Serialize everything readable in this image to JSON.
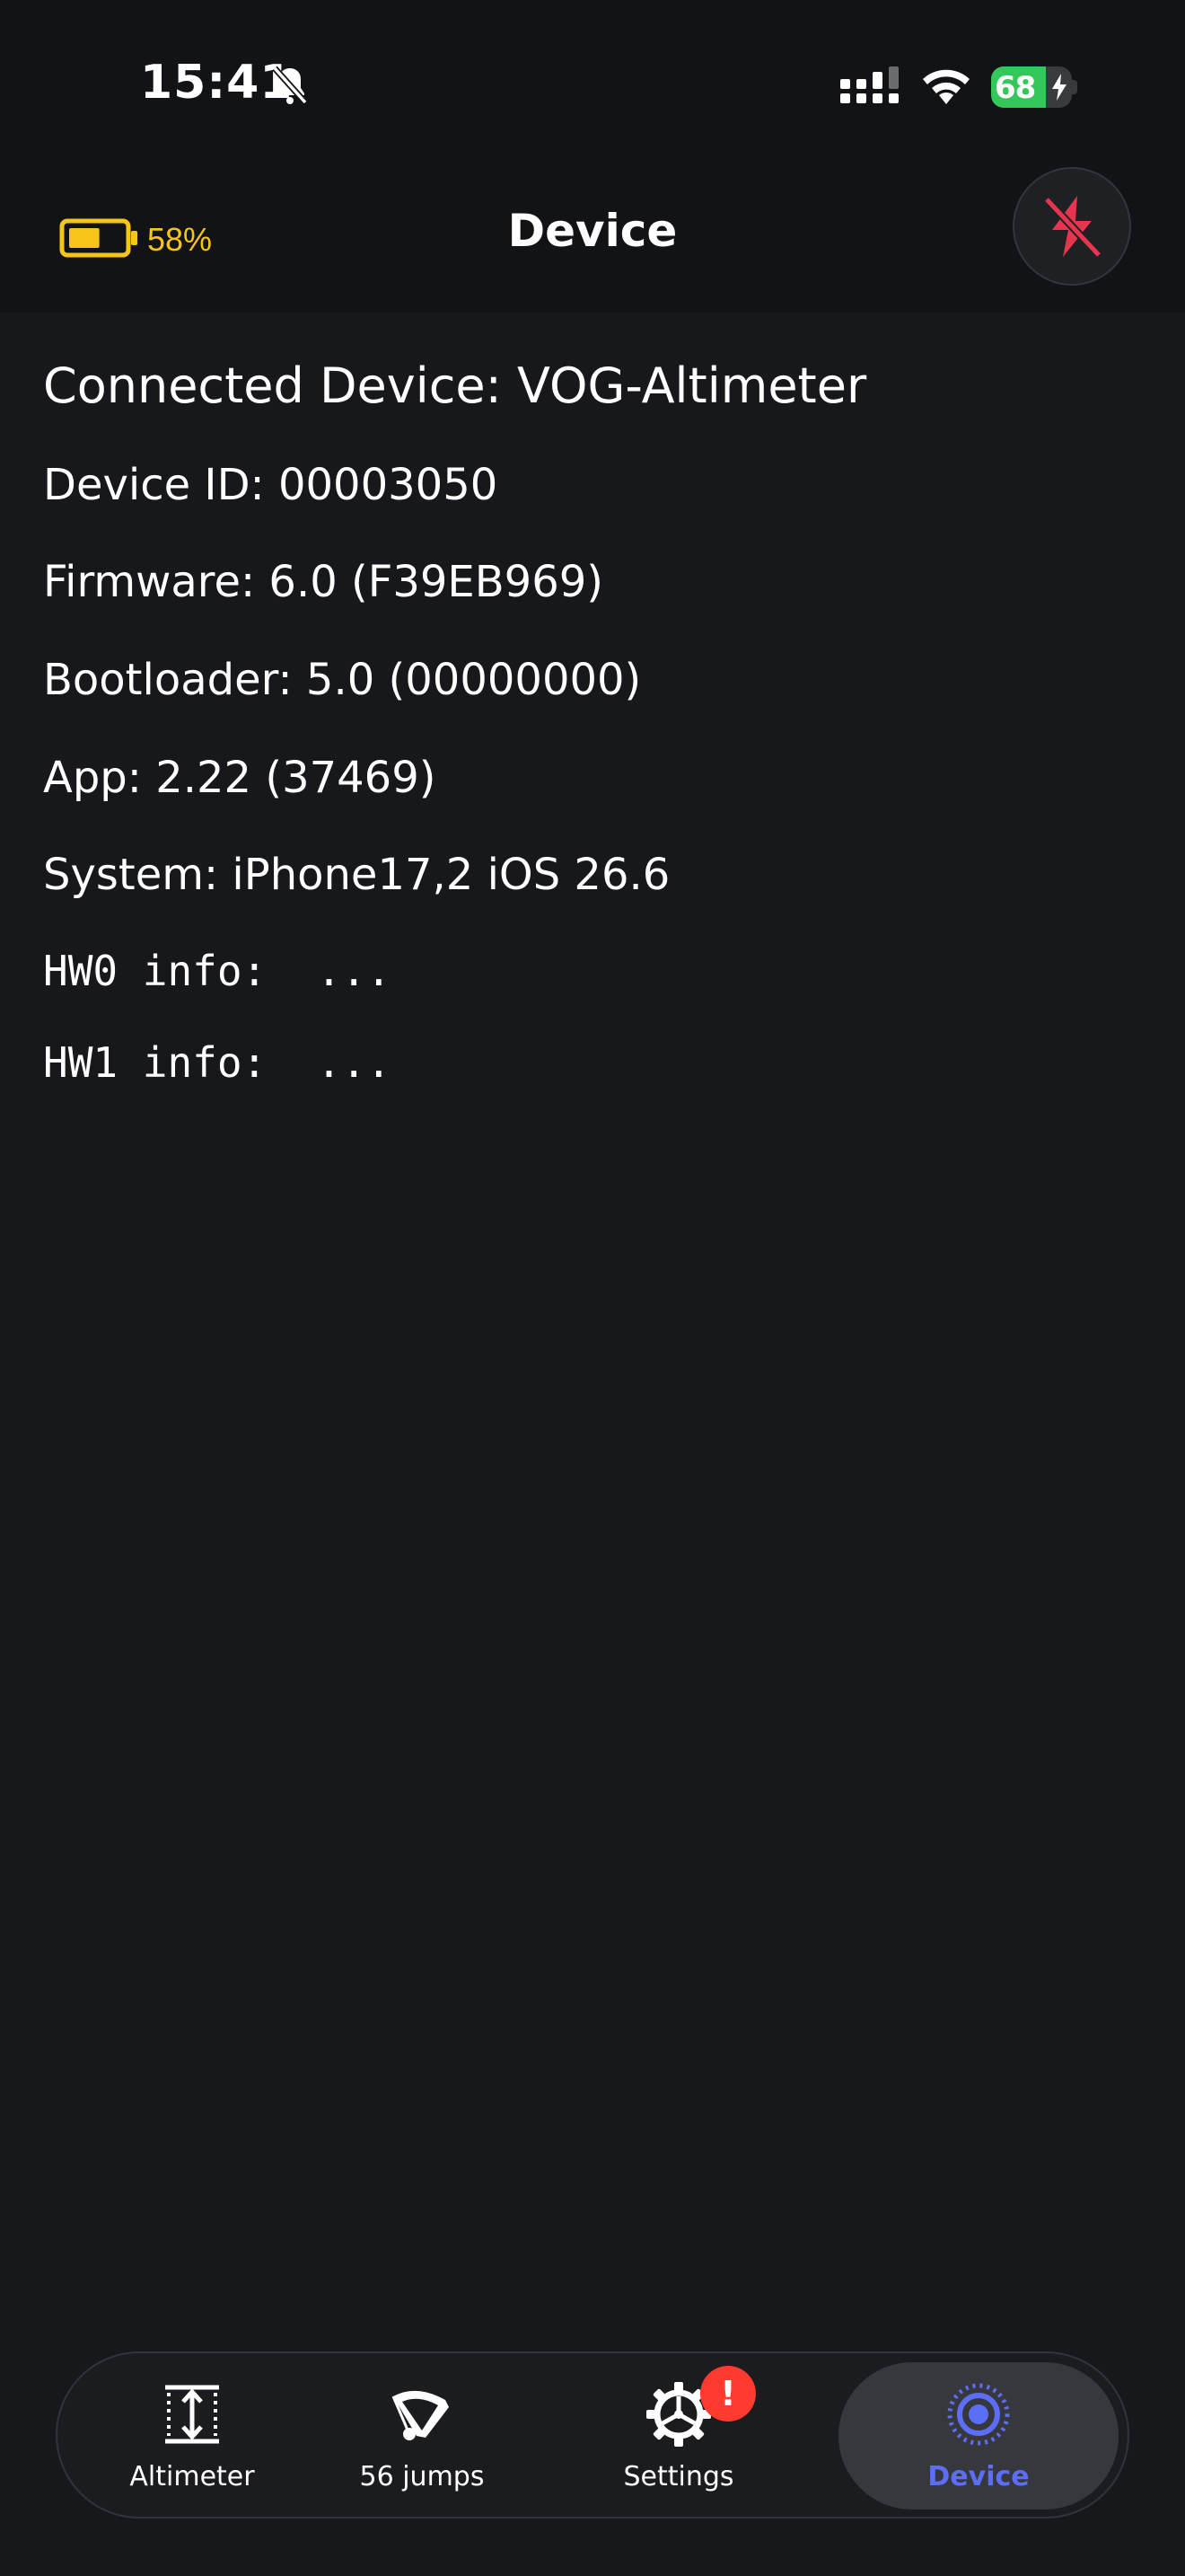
{
  "status_bar": {
    "time": "15:41",
    "battery_percent": "68",
    "battery_level": 0.68,
    "icons": [
      "bell-slash-icon",
      "cellular-signal-icon",
      "wifi-icon",
      "battery-charging-icon"
    ]
  },
  "header": {
    "title": "Device",
    "device_battery_percent": "58%",
    "device_battery_level": 0.58,
    "device_battery_color": "#f5c518",
    "disconnect_icon": "bolt-slash-icon",
    "disconnect_color": "#e8354f"
  },
  "info": {
    "connected_device": "Connected Device: VOG-Altimeter",
    "device_id": "Device ID: 00003050",
    "firmware": "Firmware: 6.0 (F39EB969)",
    "bootloader": "Bootloader: 5.0 (00000000)",
    "app": "App: 2.22 (37469)",
    "system": "System: iPhone17,2 iOS 26.6",
    "hw0": "HW0 info:  ...",
    "hw1": "HW1 info:  ..."
  },
  "tabs": [
    {
      "label": "Altimeter",
      "icon": "altimeter-icon",
      "active": false
    },
    {
      "label": "56 jumps",
      "icon": "parachute-icon",
      "active": false
    },
    {
      "label": "Settings",
      "icon": "gear-icon",
      "active": false,
      "badge": "!"
    },
    {
      "label": "Device",
      "icon": "device-target-icon",
      "active": true
    }
  ],
  "colors": {
    "background": "#17181c",
    "accent": "#5b6ef5",
    "badge": "#ff3b30"
  }
}
